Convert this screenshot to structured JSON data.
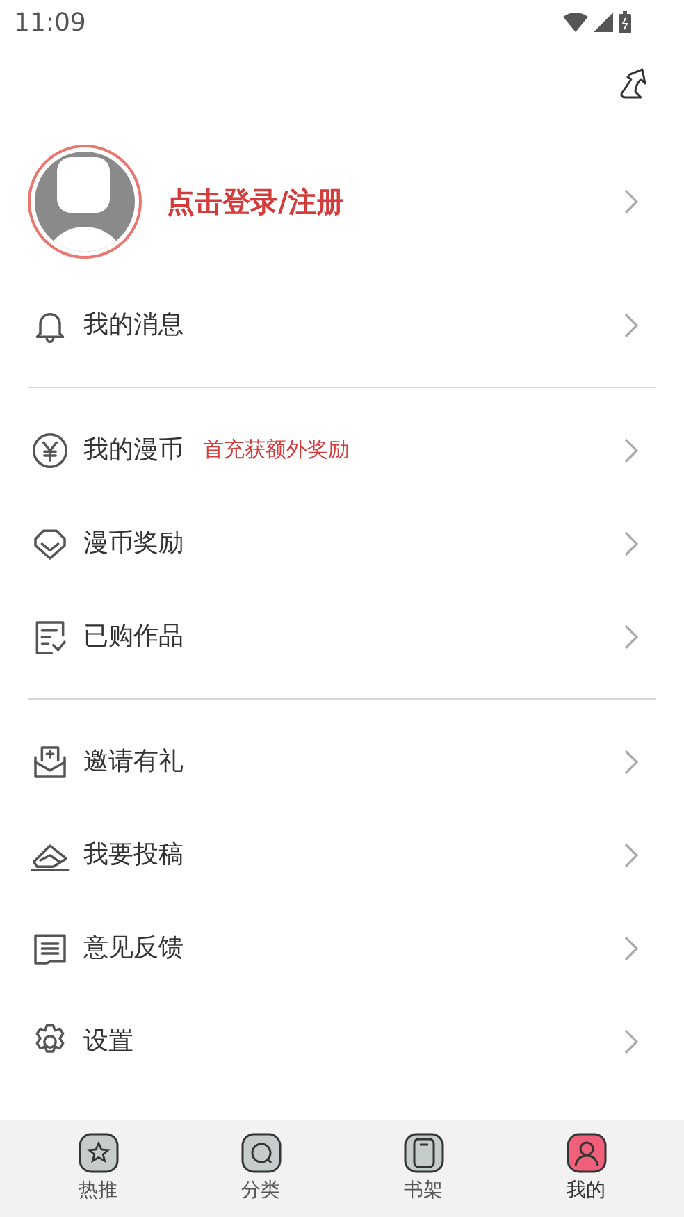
{
  "status_bar": {
    "time": "11:09"
  },
  "profile": {
    "login_text": "点击登录/注册"
  },
  "sections": [
    {
      "items": [
        {
          "label": "我的消息"
        }
      ]
    },
    {
      "items": [
        {
          "label": "我的漫币",
          "badge": "首充获额外奖励"
        },
        {
          "label": "漫币奖励"
        },
        {
          "label": "已购作品"
        }
      ]
    },
    {
      "items": [
        {
          "label": "邀请有礼"
        },
        {
          "label": "我要投稿"
        },
        {
          "label": "意见反馈"
        },
        {
          "label": "设置"
        }
      ]
    }
  ],
  "tabs": [
    {
      "label": "热推",
      "selected": false
    },
    {
      "label": "分类",
      "selected": false
    },
    {
      "label": "书架",
      "selected": false
    },
    {
      "label": "我的",
      "selected": true
    }
  ]
}
